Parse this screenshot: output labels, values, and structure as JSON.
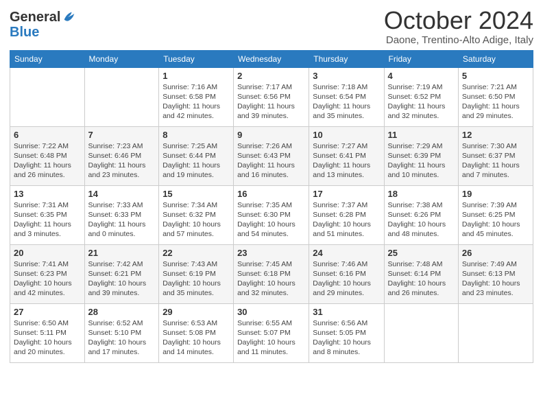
{
  "logo": {
    "line1": "General",
    "line2": "Blue"
  },
  "header": {
    "month": "October 2024",
    "location": "Daone, Trentino-Alto Adige, Italy"
  },
  "weekdays": [
    "Sunday",
    "Monday",
    "Tuesday",
    "Wednesday",
    "Thursday",
    "Friday",
    "Saturday"
  ],
  "weeks": [
    [
      {
        "day": "",
        "info": ""
      },
      {
        "day": "",
        "info": ""
      },
      {
        "day": "1",
        "info": "Sunrise: 7:16 AM\nSunset: 6:58 PM\nDaylight: 11 hours and 42 minutes."
      },
      {
        "day": "2",
        "info": "Sunrise: 7:17 AM\nSunset: 6:56 PM\nDaylight: 11 hours and 39 minutes."
      },
      {
        "day": "3",
        "info": "Sunrise: 7:18 AM\nSunset: 6:54 PM\nDaylight: 11 hours and 35 minutes."
      },
      {
        "day": "4",
        "info": "Sunrise: 7:19 AM\nSunset: 6:52 PM\nDaylight: 11 hours and 32 minutes."
      },
      {
        "day": "5",
        "info": "Sunrise: 7:21 AM\nSunset: 6:50 PM\nDaylight: 11 hours and 29 minutes."
      }
    ],
    [
      {
        "day": "6",
        "info": "Sunrise: 7:22 AM\nSunset: 6:48 PM\nDaylight: 11 hours and 26 minutes."
      },
      {
        "day": "7",
        "info": "Sunrise: 7:23 AM\nSunset: 6:46 PM\nDaylight: 11 hours and 23 minutes."
      },
      {
        "day": "8",
        "info": "Sunrise: 7:25 AM\nSunset: 6:44 PM\nDaylight: 11 hours and 19 minutes."
      },
      {
        "day": "9",
        "info": "Sunrise: 7:26 AM\nSunset: 6:43 PM\nDaylight: 11 hours and 16 minutes."
      },
      {
        "day": "10",
        "info": "Sunrise: 7:27 AM\nSunset: 6:41 PM\nDaylight: 11 hours and 13 minutes."
      },
      {
        "day": "11",
        "info": "Sunrise: 7:29 AM\nSunset: 6:39 PM\nDaylight: 11 hours and 10 minutes."
      },
      {
        "day": "12",
        "info": "Sunrise: 7:30 AM\nSunset: 6:37 PM\nDaylight: 11 hours and 7 minutes."
      }
    ],
    [
      {
        "day": "13",
        "info": "Sunrise: 7:31 AM\nSunset: 6:35 PM\nDaylight: 11 hours and 3 minutes."
      },
      {
        "day": "14",
        "info": "Sunrise: 7:33 AM\nSunset: 6:33 PM\nDaylight: 11 hours and 0 minutes."
      },
      {
        "day": "15",
        "info": "Sunrise: 7:34 AM\nSunset: 6:32 PM\nDaylight: 10 hours and 57 minutes."
      },
      {
        "day": "16",
        "info": "Sunrise: 7:35 AM\nSunset: 6:30 PM\nDaylight: 10 hours and 54 minutes."
      },
      {
        "day": "17",
        "info": "Sunrise: 7:37 AM\nSunset: 6:28 PM\nDaylight: 10 hours and 51 minutes."
      },
      {
        "day": "18",
        "info": "Sunrise: 7:38 AM\nSunset: 6:26 PM\nDaylight: 10 hours and 48 minutes."
      },
      {
        "day": "19",
        "info": "Sunrise: 7:39 AM\nSunset: 6:25 PM\nDaylight: 10 hours and 45 minutes."
      }
    ],
    [
      {
        "day": "20",
        "info": "Sunrise: 7:41 AM\nSunset: 6:23 PM\nDaylight: 10 hours and 42 minutes."
      },
      {
        "day": "21",
        "info": "Sunrise: 7:42 AM\nSunset: 6:21 PM\nDaylight: 10 hours and 39 minutes."
      },
      {
        "day": "22",
        "info": "Sunrise: 7:43 AM\nSunset: 6:19 PM\nDaylight: 10 hours and 35 minutes."
      },
      {
        "day": "23",
        "info": "Sunrise: 7:45 AM\nSunset: 6:18 PM\nDaylight: 10 hours and 32 minutes."
      },
      {
        "day": "24",
        "info": "Sunrise: 7:46 AM\nSunset: 6:16 PM\nDaylight: 10 hours and 29 minutes."
      },
      {
        "day": "25",
        "info": "Sunrise: 7:48 AM\nSunset: 6:14 PM\nDaylight: 10 hours and 26 minutes."
      },
      {
        "day": "26",
        "info": "Sunrise: 7:49 AM\nSunset: 6:13 PM\nDaylight: 10 hours and 23 minutes."
      }
    ],
    [
      {
        "day": "27",
        "info": "Sunrise: 6:50 AM\nSunset: 5:11 PM\nDaylight: 10 hours and 20 minutes."
      },
      {
        "day": "28",
        "info": "Sunrise: 6:52 AM\nSunset: 5:10 PM\nDaylight: 10 hours and 17 minutes."
      },
      {
        "day": "29",
        "info": "Sunrise: 6:53 AM\nSunset: 5:08 PM\nDaylight: 10 hours and 14 minutes."
      },
      {
        "day": "30",
        "info": "Sunrise: 6:55 AM\nSunset: 5:07 PM\nDaylight: 10 hours and 11 minutes."
      },
      {
        "day": "31",
        "info": "Sunrise: 6:56 AM\nSunset: 5:05 PM\nDaylight: 10 hours and 8 minutes."
      },
      {
        "day": "",
        "info": ""
      },
      {
        "day": "",
        "info": ""
      }
    ]
  ]
}
